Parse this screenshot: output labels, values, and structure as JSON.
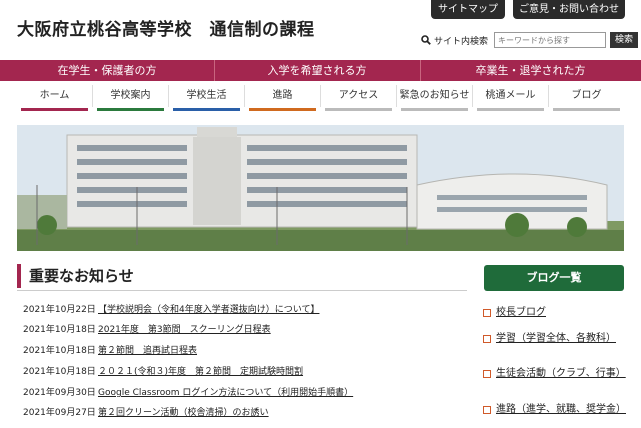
{
  "header": {
    "title": "大阪府立桃谷高等学校　通信制の課程",
    "sitemap_label": "サイトマップ",
    "contact_label": "ご意見・お問い合わせ"
  },
  "search": {
    "label": "サイト内検索",
    "placeholder": "キーワードから探す",
    "button_label": "検索"
  },
  "audience_bar": [
    {
      "label": "在学生・保護者の方"
    },
    {
      "label": "入学を希望される方"
    },
    {
      "label": "卒業生・退学された方"
    }
  ],
  "nav": {
    "tabs": [
      {
        "label": "ホーム"
      },
      {
        "label": "学校案内"
      },
      {
        "label": "学校生活"
      },
      {
        "label": "進路"
      },
      {
        "label": "アクセス"
      },
      {
        "label": "緊急のお知らせ"
      },
      {
        "label": "桃通メール"
      },
      {
        "label": "ブログ"
      }
    ]
  },
  "notices": {
    "title": "重要なお知らせ",
    "items": [
      {
        "date": "2021年10月22日",
        "text": "【学校説明会（令和4年度入学者選抜向け）について】"
      },
      {
        "date": "2021年10月18日",
        "text": "2021年度　第3節間　スクーリング日程表"
      },
      {
        "date": "2021年10月18日",
        "text": "第２節間　追再試日程表"
      },
      {
        "date": "2021年10月18日",
        "text": "２０２１(令和３)年度　第２節間　定期試験時間割"
      },
      {
        "date": "2021年09月30日",
        "text": "Google Classroom ログイン方法について（利用開始手順書）"
      },
      {
        "date": "2021年09月27日",
        "text": "第２回クリーン活動（校舎清掃）のお誘い"
      }
    ]
  },
  "blog": {
    "button_label": "ブログ一覧",
    "items": [
      {
        "label": "校長ブログ"
      },
      {
        "label": "学習（学習全体、各教科）"
      },
      {
        "label": "生徒会活動（クラブ、行事）"
      },
      {
        "label": "進路（進学、就職、奨学金）"
      }
    ]
  },
  "colors": {
    "accent": "#a3264f",
    "blog_green": "#1f6b3a",
    "dark_button": "#2b2b2b"
  }
}
